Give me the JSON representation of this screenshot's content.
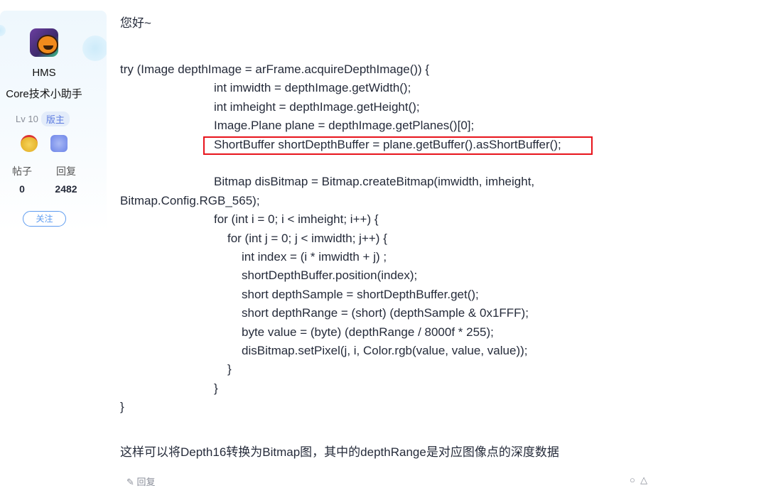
{
  "author": {
    "name_line1": "HMS",
    "name_line2": "Core技术小助手",
    "level": "Lv 10",
    "role_badge": "版主",
    "medals": [
      "gold-medal-icon",
      "blue-hexagon-chat-badge-icon"
    ],
    "posts_label": "帖子",
    "posts_value": "0",
    "replies_label": "回复",
    "replies_value": "2482",
    "follow_label": "关注"
  },
  "post": {
    "greeting": "您好~",
    "code_lines": [
      {
        "indent": 0,
        "text": "try (Image depthImage = arFrame.acquireDepthImage()) {"
      },
      {
        "indent": 132,
        "text": "int imwidth = depthImage.getWidth();"
      },
      {
        "indent": 132,
        "text": "int imheight = depthImage.getHeight();"
      },
      {
        "indent": 132,
        "text": "Image.Plane plane = depthImage.getPlanes()[0];"
      },
      {
        "indent": 132,
        "text": "ShortBuffer shortDepthBuffer = plane.getBuffer().asShortBuffer();"
      },
      {
        "indent": 0,
        "text": ""
      },
      {
        "indent": 132,
        "text": "Bitmap disBitmap = Bitmap.createBitmap(imwidth, imheight,"
      },
      {
        "indent": 0,
        "text": "Bitmap.Config.RGB_565);"
      },
      {
        "indent": 132,
        "text": "for (int i = 0; i < imheight; i++) {"
      },
      {
        "indent": 151,
        "text": "for (int j = 0; j < imwidth; j++) {"
      },
      {
        "indent": 171,
        "text": "int index = (i * imwidth + j) ;"
      },
      {
        "indent": 171,
        "text": "shortDepthBuffer.position(index);"
      },
      {
        "indent": 171,
        "text": "short depthSample = shortDepthBuffer.get();"
      },
      {
        "indent": 171,
        "text": "short depthRange = (short) (depthSample & 0x1FFF);"
      },
      {
        "indent": 171,
        "text": "byte value = (byte) (depthRange / 8000f * 255);"
      },
      {
        "indent": 171,
        "text": "disBitmap.setPixel(j, i, Color.rgb(value, value, value));"
      },
      {
        "indent": 151,
        "text": "}"
      },
      {
        "indent": 132,
        "text": "}"
      },
      {
        "indent": 0,
        "text": "}"
      }
    ],
    "highlight_color": "#e8141c",
    "summary": "这样可以将Depth16转换为Bitmap图，其中的depthRange是对应图像点的深度数据",
    "reply_label": "回复"
  }
}
